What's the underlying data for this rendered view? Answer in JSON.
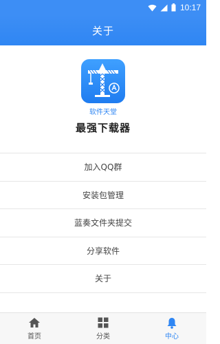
{
  "status_bar": {
    "time": "10:17",
    "icons": [
      "wifi-icon",
      "signal-icon",
      "battery-icon"
    ]
  },
  "header": {
    "title": "关于"
  },
  "logo": {
    "icon": "crane-icon",
    "caption": "软件天堂",
    "app_name": "最强下载器"
  },
  "menu": {
    "items": [
      {
        "label": "加入QQ群"
      },
      {
        "label": "安装包管理"
      },
      {
        "label": "蓝奏文件夹提交"
      },
      {
        "label": "分享软件"
      },
      {
        "label": "关于"
      }
    ]
  },
  "bottom_nav": {
    "items": [
      {
        "label": "首页",
        "icon": "home-icon",
        "active": false
      },
      {
        "label": "分类",
        "icon": "grid-icon",
        "active": false
      },
      {
        "label": "中心",
        "icon": "bell-icon",
        "active": true
      }
    ]
  },
  "colors": {
    "primary": "#2f86f3",
    "status_bar": "#3d8ef5",
    "divider": "#e6e6e6"
  }
}
